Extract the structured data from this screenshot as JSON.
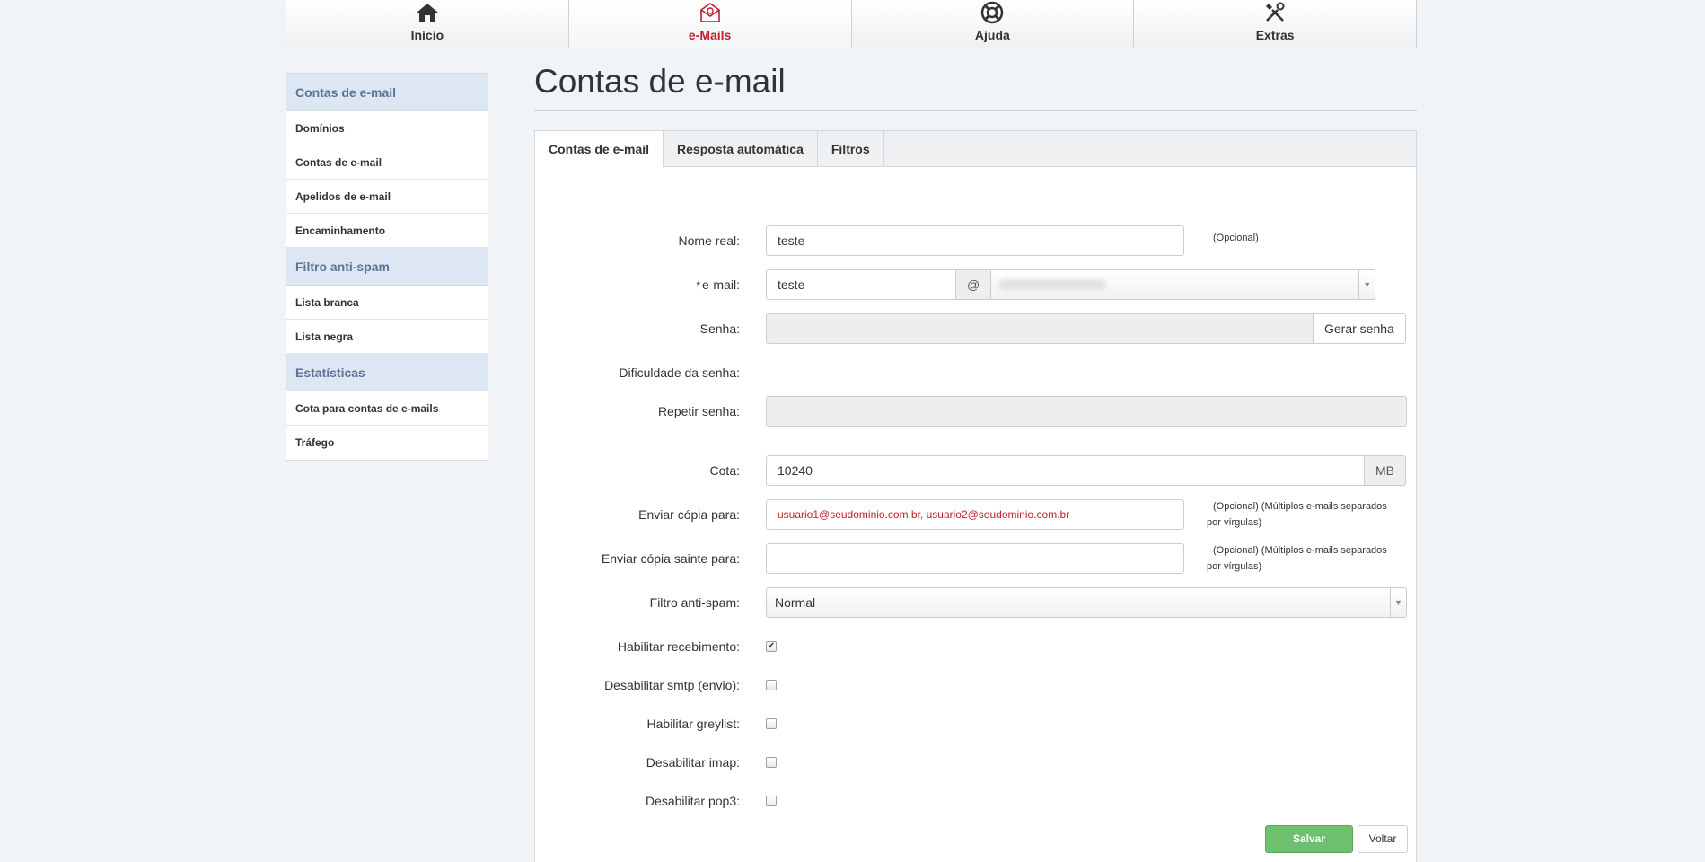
{
  "nav": {
    "items": [
      {
        "label": "Início",
        "icon": "home-icon"
      },
      {
        "label": "e-Mails",
        "icon": "email-icon",
        "active": true
      },
      {
        "label": "Ajuda",
        "icon": "help-icon"
      },
      {
        "label": "Extras",
        "icon": "tools-icon"
      }
    ]
  },
  "sidebar": {
    "groups": [
      {
        "title": "Contas de e-mail",
        "items": [
          "Domínios",
          "Contas de e-mail",
          "Apelidos de e-mail",
          "Encaminhamento"
        ]
      },
      {
        "title": "Filtro anti-spam",
        "items": [
          "Lista branca",
          "Lista negra"
        ]
      },
      {
        "title": "Estatísticas",
        "items": [
          "Cota para contas de e-mails",
          "Tráfego"
        ]
      }
    ]
  },
  "page": {
    "title": "Contas de e-mail"
  },
  "tabs": [
    "Contas de e-mail",
    "Resposta automática",
    "Filtros"
  ],
  "form": {
    "real_name": {
      "label": "Nome real:",
      "value": "teste",
      "hint": "(Opcional)"
    },
    "email": {
      "required_mark": "*",
      "label": "e-mail:",
      "value": "teste",
      "at": "@"
    },
    "password": {
      "label": "Senha:",
      "generate_label": "Gerar senha"
    },
    "strength": {
      "label": "Dificuldade da senha:"
    },
    "repeat": {
      "label": "Repetir senha:"
    },
    "quota": {
      "label": "Cota:",
      "value": "10240",
      "unit": "MB"
    },
    "copy_to": {
      "label": "Enviar cópia para:",
      "placeholder": "usuario1@seudominio.com.br, usuario2@seudominio.com.br",
      "hint_line1": "(Opcional) (Múltiplos e-mails separados",
      "hint_line2": "por vírgulas)"
    },
    "copy_out": {
      "label": "Enviar cópia sainte para:",
      "hint_line1": "(Opcional) (Múltiplos e-mails separados",
      "hint_line2": "por vírgulas)"
    },
    "spam": {
      "label": "Filtro anti-spam:",
      "value": "Normal"
    },
    "checks": [
      {
        "label": "Habilitar recebimento:",
        "checked": true
      },
      {
        "label": "Desabilitar smtp (envio):",
        "checked": false
      },
      {
        "label": "Habilitar greylist:",
        "checked": false
      },
      {
        "label": "Desabilitar imap:",
        "checked": false
      },
      {
        "label": "Desabilitar pop3:",
        "checked": false
      }
    ],
    "save_label": "Salvar",
    "back_label": "Voltar"
  },
  "colors": {
    "accent": "#c0202d",
    "save": "#6ebf6e",
    "placeholder": "#c0202d"
  }
}
